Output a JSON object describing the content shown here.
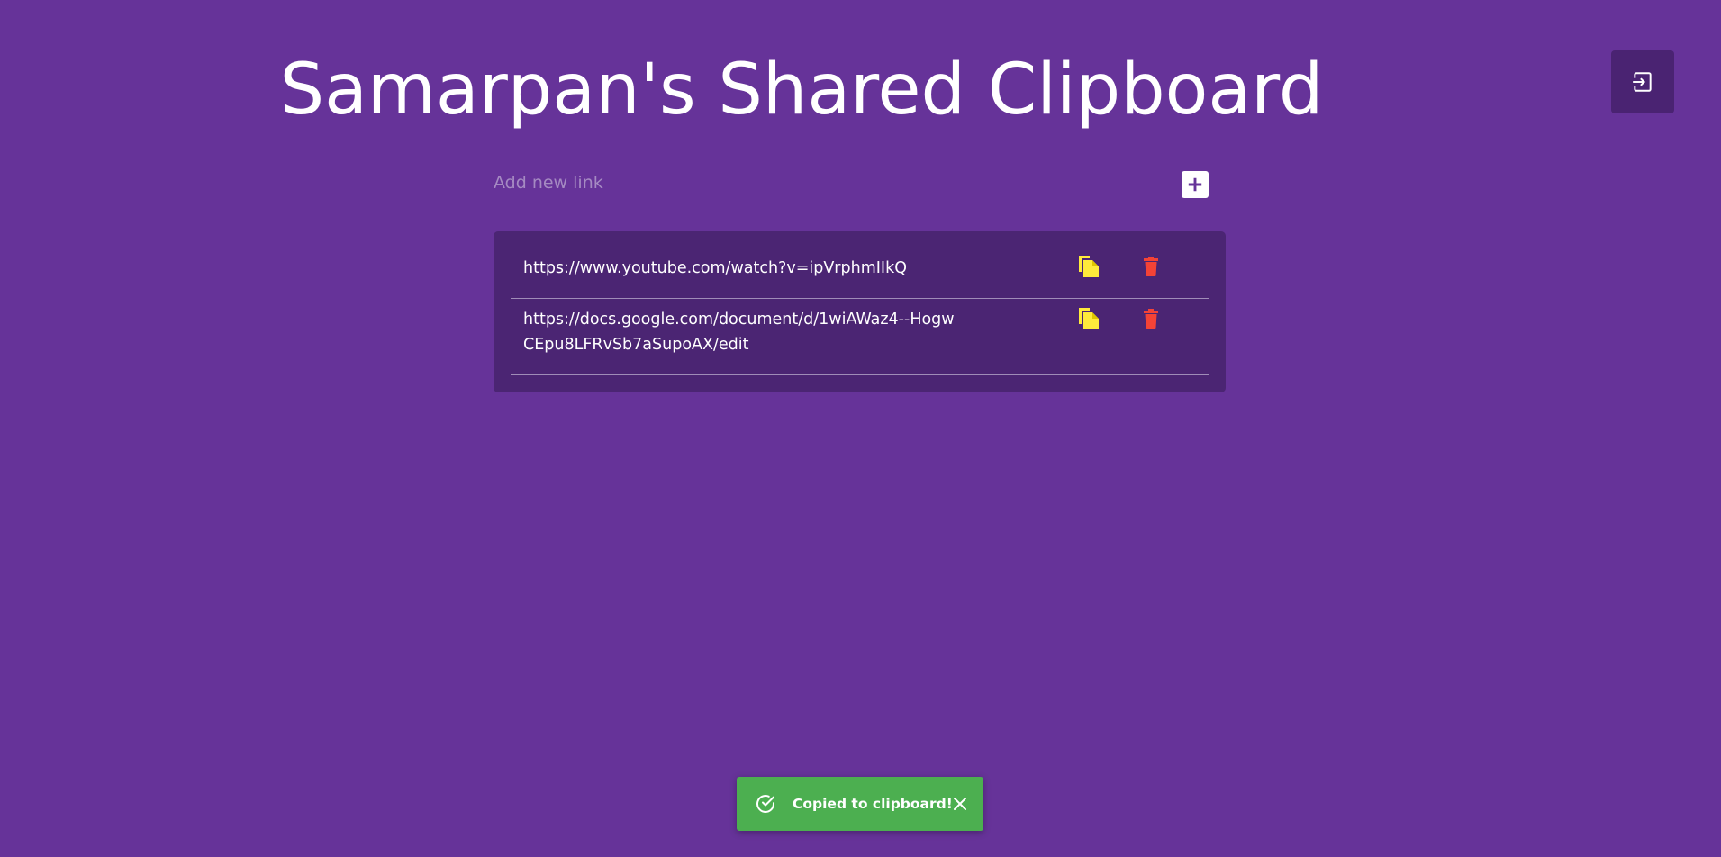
{
  "header": {
    "title": "Samarpan's Shared Clipboard",
    "logout_icon": "logout-icon"
  },
  "add_link": {
    "placeholder": "Add new link",
    "value": "",
    "add_icon": "plus-icon"
  },
  "links": [
    {
      "url": "https://www.youtube.com/watch?v=ipVrphmIIkQ",
      "copy_icon": "copy-icon",
      "delete_icon": "trash-icon"
    },
    {
      "url": "https://docs.google.com/document/d/1wiAWaz4--HogwCEpu8LFRvSb7aSupoAX/edit",
      "copy_icon": "copy-icon",
      "delete_icon": "trash-icon"
    }
  ],
  "toast": {
    "message": "Copied to clipboard!",
    "status_icon": "check-circle-icon",
    "close_icon": "close-icon"
  },
  "colors": {
    "background": "#663399",
    "card": "#4b2573",
    "logout_button": "#4a2372",
    "copy_icon": "#ffeb3b",
    "delete_icon": "#f44336",
    "toast": "#4caf50"
  }
}
